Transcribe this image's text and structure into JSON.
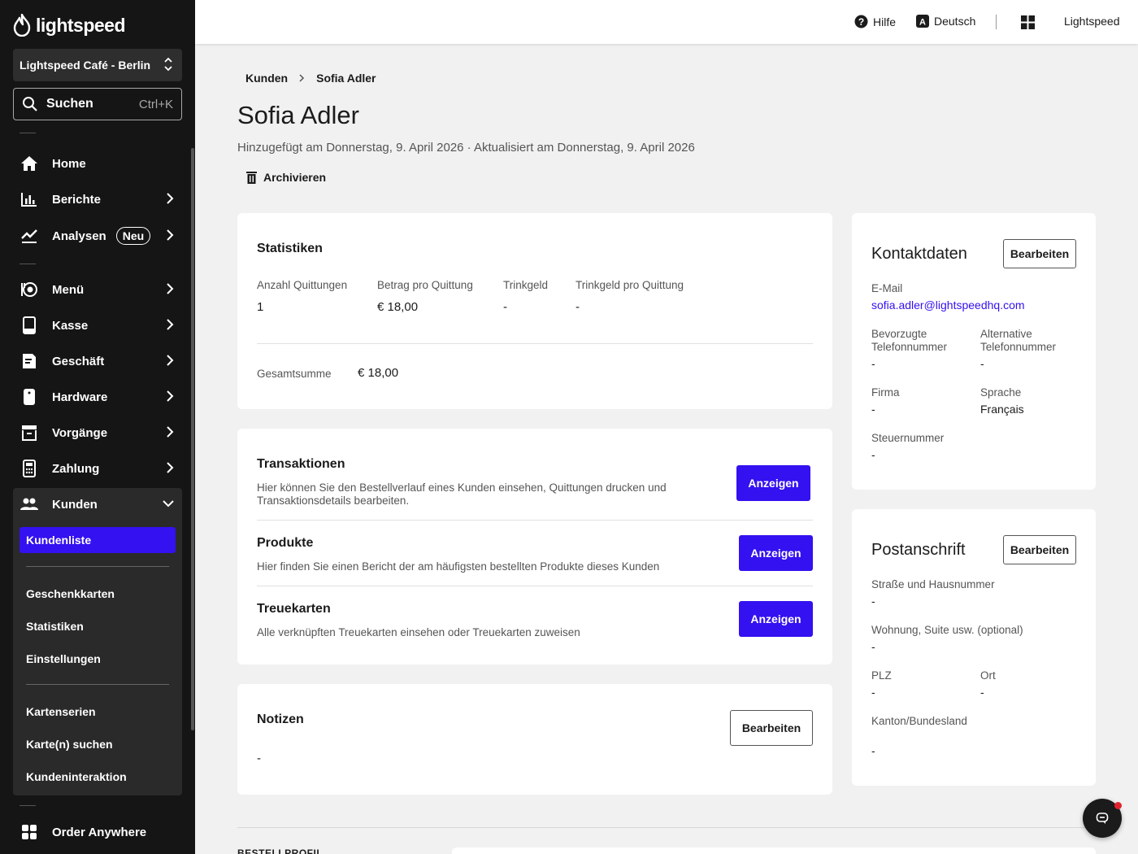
{
  "sidebar": {
    "logo": "lightspeed",
    "store": "Lightspeed Café - Berlin",
    "search_label": "Suchen",
    "search_shortcut": "Ctrl+K",
    "items": [
      {
        "label": "Home"
      },
      {
        "label": "Berichte"
      },
      {
        "label": "Analysen",
        "badge": "Neu"
      },
      {
        "label": "Menü"
      },
      {
        "label": "Kasse"
      },
      {
        "label": "Geschäft"
      },
      {
        "label": "Hardware"
      },
      {
        "label": "Vorgänge"
      },
      {
        "label": "Zahlung"
      },
      {
        "label": "Kunden"
      }
    ],
    "submenu": {
      "active": "Kundenliste",
      "group1": [
        "Geschenkkarten",
        "Statistiken",
        "Einstellungen"
      ],
      "group2": [
        "Kartenserien",
        "Karte(n) suchen",
        "Kundeninteraktion"
      ]
    },
    "bottom_item": "Order Anywhere"
  },
  "topbar": {
    "help": "Hilfe",
    "language": "Deutsch",
    "account": "Lightspeed"
  },
  "breadcrumb": {
    "parent": "Kunden",
    "current": "Sofia Adler"
  },
  "page": {
    "title": "Sofia Adler",
    "subtitle": "Hinzugefügt am Donnerstag, 9. April 2026 · Aktualisiert am Donnerstag, 9. April 2026",
    "archive": "Archivieren"
  },
  "stats": {
    "title": "Statistiken",
    "columns": [
      {
        "label": "Anzahl Quittungen",
        "value": "1"
      },
      {
        "label": "Betrag pro Quittung",
        "value": "€ 18,00"
      },
      {
        "label": "Trinkgeld",
        "value": "-"
      },
      {
        "label": "Trinkgeld pro Quittung",
        "value": "-"
      }
    ],
    "total_label": "Gesamtsumme",
    "total_value": "€ 18,00"
  },
  "sections": [
    {
      "title": "Transaktionen",
      "desc": "Hier können Sie den Bestellverlauf eines Kunden einsehen, Quittungen drucken und Transaktionsdetails bearbeiten.",
      "button": "Anzeigen"
    },
    {
      "title": "Produkte",
      "desc": "Hier finden Sie einen Bericht der am häufigsten bestellten Produkte dieses Kunden",
      "button": "Anzeigen"
    },
    {
      "title": "Treuekarten",
      "desc": "Alle verknüpften Treuekarten einsehen oder Treuekarten zuweisen",
      "button": "Anzeigen"
    }
  ],
  "notes": {
    "title": "Notizen",
    "button": "Bearbeiten",
    "value": "-"
  },
  "contact": {
    "title": "Kontaktdaten",
    "button": "Bearbeiten",
    "email_label": "E-Mail",
    "email": "sofia.adler@lightspeedhq.com",
    "phone_label": "Bevorzugte Telefonnummer",
    "phone": "-",
    "alt_phone_label": "Alternative Telefonnummer",
    "alt_phone": "-",
    "company_label": "Firma",
    "company": "-",
    "language_label": "Sprache",
    "language": "Français",
    "tax_label": "Steuernummer",
    "tax": "-"
  },
  "address": {
    "title": "Postanschrift",
    "button": "Bearbeiten",
    "street_label": "Straße und Hausnummer",
    "street": "-",
    "apt_label": "Wohnung, Suite usw. (optional)",
    "apt": "-",
    "zip_label": "PLZ",
    "zip": "-",
    "city_label": "Ort",
    "city": "-",
    "state_label": "Kanton/Bundesland",
    "state": "-"
  },
  "bottom_section_label": "BESTELLPROFIL",
  "colors": {
    "accent": "#3311f0",
    "sidebar": "#151515",
    "notification": "#e0242e"
  }
}
